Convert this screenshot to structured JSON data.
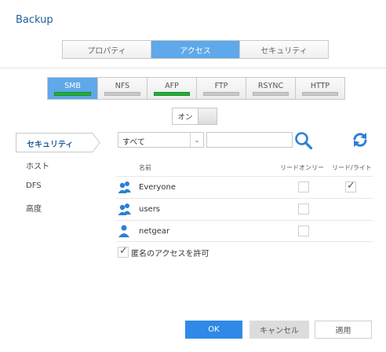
{
  "window": {
    "title": "Backup"
  },
  "main_tabs": [
    {
      "label": "プロパティ",
      "active": false
    },
    {
      "label": "アクセス",
      "active": true
    },
    {
      "label": "セキュリティ",
      "active": false
    }
  ],
  "protocol_tabs": [
    {
      "label": "SMB",
      "active": true,
      "enabled": true
    },
    {
      "label": "NFS",
      "active": false,
      "enabled": false
    },
    {
      "label": "AFP",
      "active": false,
      "enabled": true
    },
    {
      "label": "FTP",
      "active": false,
      "enabled": false
    },
    {
      "label": "RSYNC",
      "active": false,
      "enabled": false
    },
    {
      "label": "HTTP",
      "active": false,
      "enabled": false
    }
  ],
  "toggle": {
    "label": "オン"
  },
  "sidebar": {
    "items": [
      {
        "label": "セキュリティ",
        "active": true
      },
      {
        "label": "ホスト",
        "active": false
      },
      {
        "label": "DFS",
        "active": false
      },
      {
        "label": "高度",
        "active": false
      }
    ]
  },
  "filter": {
    "selected": "すべて",
    "search_value": ""
  },
  "table": {
    "headers": {
      "name": "名前",
      "read_only": "リードオンリー",
      "read_write": "リード/ライト"
    },
    "rows": [
      {
        "name": "Everyone",
        "icon": "group-icon",
        "read_only": false,
        "read_write": true
      },
      {
        "name": "users",
        "icon": "group-icon",
        "read_only": false,
        "read_write": false
      },
      {
        "name": "netgear",
        "icon": "user-icon",
        "read_only": false,
        "read_write": false
      }
    ]
  },
  "anonymous": {
    "label": "匿名のアクセスを許可",
    "checked": true
  },
  "buttons": {
    "ok": "OK",
    "cancel": "キャンセル",
    "apply": "適用"
  },
  "colors": {
    "accent": "#2e8ae6",
    "tab_active": "#5fa8e9",
    "title": "#1f5c99",
    "enabled_bar": "#22b03a",
    "icon_blue": "#2b7fd6"
  }
}
